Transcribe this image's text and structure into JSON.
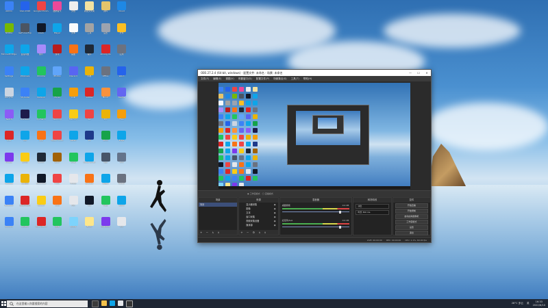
{
  "desktop": {
    "icons": [
      {
        "label": "Admin",
        "color": "#3b82f6"
      },
      {
        "label": "Visio 2016",
        "color": "#2563eb"
      },
      {
        "label": "Google Chrome",
        "color": "#ef4444"
      },
      {
        "label": "酷狗音乐",
        "color": "#ec4899"
      },
      {
        "label": "文档",
        "color": "#eeeeee"
      },
      {
        "label": "新建文件夹",
        "color": "#f3e2a0"
      },
      {
        "label": "资料",
        "color": "#e5c46b"
      },
      {
        "label": "Cloud",
        "color": "#1e88e5"
      },
      {
        "label": "NVIDIA",
        "color": "#76b900"
      },
      {
        "label": "GeForce Exp",
        "color": "#4b5563"
      },
      {
        "label": "Clock",
        "color": "#111827"
      },
      {
        "label": "Player",
        "color": "#0ea5e9"
      },
      {
        "label": "文本",
        "color": "#f8fafc"
      },
      {
        "label": "工具",
        "color": "#a3a3a3"
      },
      {
        "label": "设置",
        "color": "#9ca3af"
      },
      {
        "label": "文件",
        "color": "#fbbf24"
      },
      {
        "label": "Microsoft Edge",
        "color": "#0ea5e9"
      },
      {
        "label": "百度网盘",
        "color": "#0ea5e9"
      },
      {
        "label": "照片",
        "color": "#a78bfa"
      },
      {
        "label": "游戏",
        "color": "#b91c1c"
      },
      {
        "label": "画图",
        "color": "#f97316"
      },
      {
        "label": "程序",
        "color": "#1f2937"
      },
      {
        "label": "Among Us",
        "color": "#dc2626"
      },
      {
        "label": "应用",
        "color": "#6b7280"
      },
      {
        "label": "Settings",
        "color": "#3b82f6"
      },
      {
        "label": "Windows",
        "color": "#0ea5e9"
      },
      {
        "label": "Chrome",
        "color": "#22c55e"
      },
      {
        "label": "Photos",
        "color": "#60a5fa"
      },
      {
        "label": "Discord",
        "color": "#5865f2"
      },
      {
        "label": "网易",
        "color": "#eab308"
      },
      {
        "label": "Office",
        "color": "#6b7280"
      },
      {
        "label": "Word",
        "color": "#2563eb"
      },
      {
        "label": "Recycle",
        "color": "#cbd5e1"
      },
      {
        "label": "VS Code",
        "color": "#3b82f6"
      },
      {
        "label": "Outlook",
        "color": "#0ea5e9"
      },
      {
        "label": "Excel",
        "color": "#16a34a"
      },
      {
        "label": "Anki",
        "color": "#f59e0b"
      },
      {
        "label": "Adobe",
        "color": "#dc2626"
      },
      {
        "label": "Music",
        "color": "#fb923c"
      },
      {
        "label": "Teams",
        "color": "#6366f1"
      },
      {
        "label": "Twitch",
        "color": "#8b5cf6"
      },
      {
        "label": "Premiere",
        "color": "#1e1b4b"
      },
      {
        "label": "Pycharm",
        "color": "#22c55e"
      },
      {
        "label": "Warning",
        "color": "#ef4444"
      },
      {
        "label": "Mercury",
        "color": "#facc15"
      },
      {
        "label": "Rec",
        "color": "#ef4444"
      },
      {
        "label": "Zip",
        "color": "#eab308"
      },
      {
        "label": "Files",
        "color": "#f59e0b"
      },
      {
        "label": "Tube",
        "color": "#dc2626"
      },
      {
        "label": "QQ",
        "color": "#0ea5e9"
      },
      {
        "label": "微博",
        "color": "#f97316"
      },
      {
        "label": "Apple Music",
        "color": "#ef4444"
      },
      {
        "label": "Safari",
        "color": "#0ea5e9"
      },
      {
        "label": "PS",
        "color": "#1e3a8a"
      },
      {
        "label": "Xbox",
        "color": "#16a34a"
      },
      {
        "label": "Edge",
        "color": "#0ea5e9"
      },
      {
        "label": "Picasa",
        "color": "#7c3aed"
      },
      {
        "label": "Emoji",
        "color": "#facc15"
      },
      {
        "label": "Steam",
        "color": "#1f2937"
      },
      {
        "label": "GIMP",
        "color": "#a16207"
      },
      {
        "label": "Chat",
        "color": "#22c55e"
      },
      {
        "label": "Cloud Drive",
        "color": "#0ea5e9"
      },
      {
        "label": "App",
        "color": "#475569"
      },
      {
        "label": "Tool",
        "color": "#64748b"
      },
      {
        "label": "Tencent",
        "color": "#0ea5e9"
      },
      {
        "label": "QQ音乐",
        "color": "#eab308"
      },
      {
        "label": "Stickman",
        "color": "#111827"
      },
      {
        "label": "Foxit",
        "color": "#ef4444"
      },
      {
        "label": "Photo",
        "color": "#e5e7eb"
      },
      {
        "label": "Blender",
        "color": "#f97316"
      },
      {
        "label": "Skype",
        "color": "#0ea5e9"
      },
      {
        "label": "Vector",
        "color": "#6b7280"
      },
      {
        "label": "Network",
        "color": "#3b82f6"
      },
      {
        "label": "网易云音乐",
        "color": "#dc2626"
      },
      {
        "label": "Weixin",
        "color": "#facc15"
      },
      {
        "label": "Todo",
        "color": "#f97316"
      },
      {
        "label": "Pen",
        "color": "#e5e7eb"
      },
      {
        "label": "Cat",
        "color": "#111827"
      },
      {
        "label": "Map",
        "color": "#22c55e"
      },
      {
        "label": "Store",
        "color": "#0ea5e9"
      },
      {
        "label": "Lenovo",
        "color": "#3b82f6"
      },
      {
        "label": "Spotify",
        "color": "#22c55e"
      },
      {
        "label": "WPS Office",
        "color": "#dc2626"
      },
      {
        "label": "微信",
        "color": "#22c55e"
      },
      {
        "label": "Snow",
        "color": "#7dd3fc"
      },
      {
        "label": "Book",
        "color": "#fde68a"
      },
      {
        "label": "OneNote",
        "color": "#7c3aed"
      },
      {
        "label": "Cal",
        "color": "#e5e7eb"
      }
    ]
  },
  "obs": {
    "title": "OBS 27.2.4 (64-bit, windows) - 配置文件: 未命名 - 场景: 未命名",
    "menu": [
      "文件(F)",
      "编辑(E)",
      "视图(V)",
      "停靠窗口(D)",
      "配置文件(P)",
      "场景集合(S)",
      "工具(T)",
      "帮助(H)"
    ],
    "window_controls": [
      "—",
      "☐",
      "✕"
    ],
    "modes": [
      "◉ 工作室模式",
      "◯ 直播模式"
    ],
    "docks": {
      "scenes": {
        "header": "场景",
        "items": [
          "场景"
        ],
        "footer": "+ − ∧ ∨"
      },
      "sources": {
        "header": "来源",
        "items": [
          "显示器采集",
          "图像",
          "文本",
          "窗口采集",
          "视频采集设备",
          "媒体源"
        ],
        "footer": "+ − ⚙ ∧ ∨"
      },
      "mixer": {
        "header": "混音器",
        "channels": [
          {
            "name": "桌面音频",
            "db": "0.0 dB"
          },
          {
            "name": "麦克风/Aux",
            "db": "0.0 dB"
          }
        ]
      },
      "transitions": {
        "header": "转场特效",
        "type": "淡出",
        "duration_label": "时长",
        "duration": "300 ms"
      },
      "controls": {
        "header": "控件",
        "buttons": [
          "开始直播",
          "开始录制",
          "启动虚拟摄像机",
          "工作室模式",
          "设置",
          "退出"
        ]
      }
    },
    "status": [
      "LIVE: 00:00:00",
      "REC: 00:00:00",
      "CPU: 1.1%, 60.00 fps"
    ]
  },
  "taskbar": {
    "search_placeholder": "在这里输入你要搜索的内容",
    "weather": "28°C 多云",
    "time": "16:33",
    "date": "2022/6/10",
    "ime": "英"
  }
}
